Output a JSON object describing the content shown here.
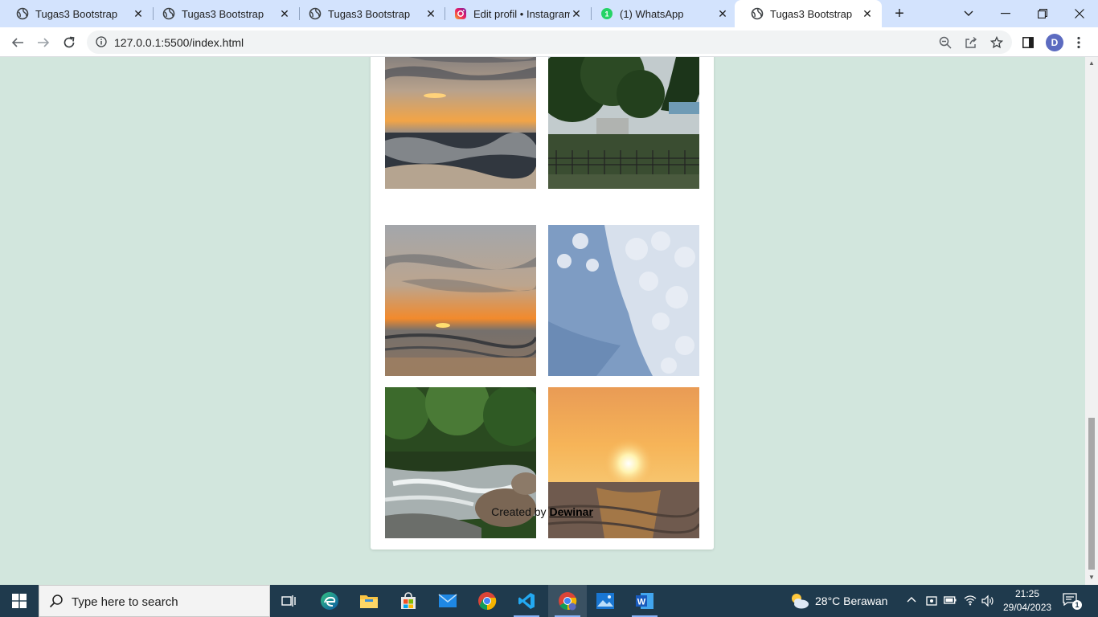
{
  "browser": {
    "tabs": [
      {
        "title": "Tugas3 Bootstrap",
        "favicon": "globe-icon"
      },
      {
        "title": "Tugas3 Bootstrap",
        "favicon": "globe-icon"
      },
      {
        "title": "Tugas3 Bootstrap",
        "favicon": "globe-icon"
      },
      {
        "title": "Edit profil • Instagram",
        "favicon": "instagram-icon"
      },
      {
        "title": "(1) WhatsApp",
        "favicon": "whatsapp-icon"
      },
      {
        "title": "Tugas3 Bootstrap",
        "favicon": "globe-icon",
        "active": true
      }
    ],
    "tab_close_glyph": "✕",
    "newtab_glyph": "+",
    "url": "127.0.0.1:5500/index.html",
    "profile_initial": "D",
    "whatsapp_badge": "1"
  },
  "page": {
    "gallery": [
      {
        "name": "beach-sunset-waves",
        "colors": [
          "#7d7f86",
          "#c9a27a",
          "#f0a040",
          "#3f4650",
          "#272c33"
        ]
      },
      {
        "name": "park-trees",
        "colors": [
          "#b9c3c6",
          "#2c4a24",
          "#1f3a1a",
          "#5a6a4e",
          "#2f3b2a"
        ]
      },
      {
        "name": "sunset-clouds-sea",
        "colors": [
          "#9ea1a6",
          "#c4aa90",
          "#f28a2c",
          "#6e6a6c",
          "#8c7460"
        ]
      },
      {
        "name": "cloudy-sky",
        "colors": [
          "#6f8eb6",
          "#dfe6ef",
          "#88a6c8",
          "#bccde0",
          "#5b7ca6"
        ]
      },
      {
        "name": "river-rocks-forest",
        "colors": [
          "#1f3b17",
          "#2f5624",
          "#8d9696",
          "#c9cfcf",
          "#6a5d4c"
        ]
      },
      {
        "name": "golden-sunset-sea",
        "colors": [
          "#efa45a",
          "#f6b458",
          "#fff6c8",
          "#6b5a52",
          "#a9773f"
        ]
      }
    ],
    "credit_prefix": "Created by",
    "credit_author": "Dewinar"
  },
  "taskbar": {
    "search_placeholder": "Type here to search",
    "weather": "28°C  Berawan",
    "time": "21:25",
    "date": "29/04/2023",
    "notification_count": "1"
  }
}
